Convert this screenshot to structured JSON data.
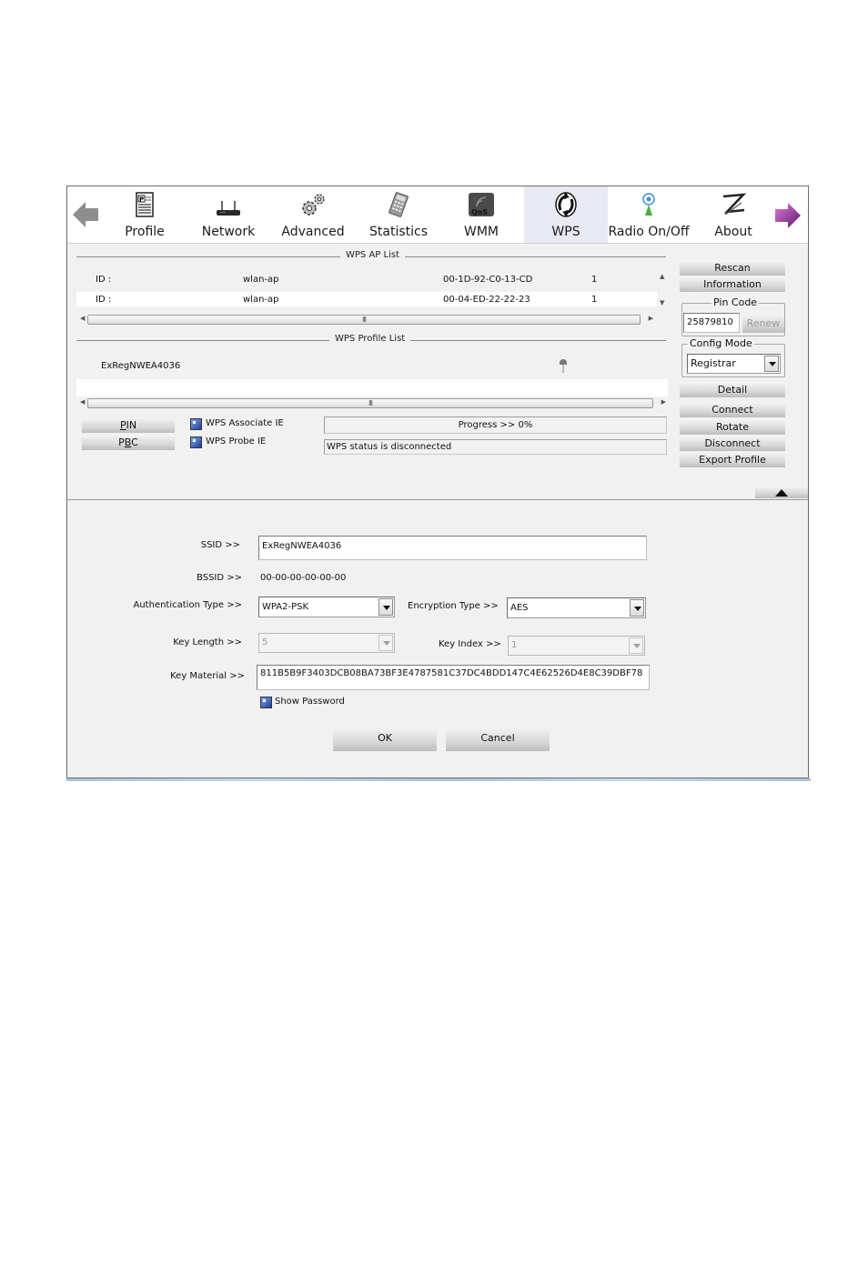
{
  "toolbar": {
    "back_icon": "back-arrow-icon",
    "forward_icon": "forward-arrow-icon",
    "items": [
      {
        "label": "Profile",
        "icon": "profile-icon",
        "active": false
      },
      {
        "label": "Network",
        "icon": "network-icon",
        "active": false
      },
      {
        "label": "Advanced",
        "icon": "gears-icon",
        "active": false
      },
      {
        "label": "Statistics",
        "icon": "calculator-icon",
        "active": false
      },
      {
        "label": "WMM",
        "icon": "qos-icon",
        "active": false
      },
      {
        "label": "WPS",
        "icon": "wps-icon",
        "active": true
      },
      {
        "label": "Radio On/Off",
        "icon": "radio-icon",
        "active": false
      },
      {
        "label": "About",
        "icon": "about-icon",
        "active": false
      }
    ]
  },
  "ap_list": {
    "title": "WPS AP List",
    "rows": [
      {
        "id_label": "ID :",
        "ssid": "wlan-ap",
        "bssid": "00-1D-92-C0-13-CD",
        "channel": "1"
      },
      {
        "id_label": "ID :",
        "ssid": "wlan-ap",
        "bssid": "00-04-ED-22-22-23",
        "channel": "1"
      }
    ],
    "scroll_grip": "III"
  },
  "profile_list": {
    "title": "WPS Profile List",
    "rows": [
      {
        "name": "ExRegNWEA4036",
        "icon": "key-icon"
      }
    ],
    "scroll_grip": "III"
  },
  "side_panel": {
    "rescan": "Rescan",
    "information": "Information",
    "pin_code_title": "Pin Code",
    "pin_code_value": "25879810",
    "renew": "Renew",
    "config_mode_title": "Config Mode",
    "config_mode_value": "Registrar",
    "detail": "Detail",
    "connect": "Connect",
    "rotate": "Rotate",
    "disconnect": "Disconnect",
    "export_profile": "Export Profile"
  },
  "wps_controls": {
    "pin_prefix": "",
    "pin_mnemonic": "P",
    "pin_rest": "IN",
    "pbc_first": "P",
    "pbc_mnemonic": "B",
    "pbc_rest": "C",
    "associate_ie": "WPS Associate IE",
    "associate_ie_checked": true,
    "probe_ie": "WPS Probe IE",
    "probe_ie_checked": true,
    "progress_text": "Progress >> 0%",
    "progress_percent": 0,
    "status_text": "WPS status is disconnected"
  },
  "detail_form": {
    "ssid_label": "SSID >>",
    "ssid_value": "ExRegNWEA4036",
    "bssid_label": "BSSID >>",
    "bssid_value": "00-00-00-00-00-00",
    "auth_label": "Authentication Type >>",
    "auth_value": "WPA2-PSK",
    "enc_label": "Encryption Type >>",
    "enc_value": "AES",
    "key_length_label": "Key Length >>",
    "key_length_value": "5",
    "key_index_label": "Key Index >>",
    "key_index_value": "1",
    "key_material_label": "Key Material >>",
    "key_material_value": "811B5B9F3403DCB08BA73BF3E4787581C37DC4BDD147C4E62526D4E8C39DBF78",
    "show_password_label": "Show Password",
    "show_password_checked": true,
    "ok": "OK",
    "cancel": "Cancel"
  }
}
